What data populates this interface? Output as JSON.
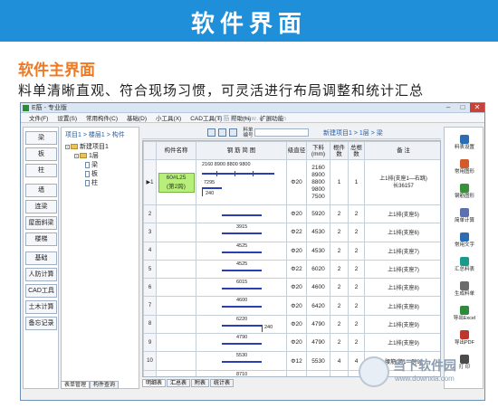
{
  "header": {
    "title": "软件界面",
    "subtitle": "软件主界面",
    "description": "料单清晰直观、符合现场习惯，可灵活进行布局调整和统计汇总"
  },
  "window": {
    "title": "E筋 - 专业版",
    "menu": [
      "文件(F)",
      "设置(S)",
      "常用构件(C)",
      "基础(D)",
      "小工具(X)",
      "CAD工具(T)",
      "帮助(H)",
      "扩展功能"
    ],
    "watermark": "E筋网  www.e-jin.cn"
  },
  "left_panel": {
    "buttons": [
      "梁",
      "板",
      "柱",
      "墙",
      "连梁",
      "屋面斜梁",
      "楼梯",
      "基础",
      "人防计算",
      "CAD工具",
      "土木计算",
      "备忘记录"
    ]
  },
  "tree": {
    "breadcrumb": "项目1 > 楼层1 > 构件",
    "nodes": [
      "新建项目1",
      "1层",
      "梁",
      "板",
      "柱"
    ],
    "bottom_tabs": [
      "表单管理",
      "构件查询"
    ]
  },
  "toolbar": {
    "label": "料单编号",
    "breadcrumb": "新建项目1 > 1层 > 梁"
  },
  "table": {
    "headers": [
      "",
      "构件名称",
      "钢 筋 简 图",
      "级直径",
      "下料(mm)",
      "根件数",
      "总根数",
      "备  注"
    ],
    "first_row": {
      "index": "1",
      "name_line1": "60#L25",
      "name_line2": "(第2跨)",
      "dims_top": "2160 8900 8800 9800",
      "dims_side": "7295",
      "dims_hook": "240",
      "grade": "Φ20",
      "length": [
        "2160",
        "8900",
        "8800",
        "9800",
        "7500"
      ],
      "count": "1",
      "total": "1",
      "note": "上1排(支座1—右跳)",
      "note2": "长36157"
    },
    "rows": [
      {
        "idx": "2",
        "dim": "",
        "grade": "Φ20",
        "len": "5920",
        "cnt": "2",
        "tot": "2",
        "note": "上1排(支座5)"
      },
      {
        "idx": "3",
        "dim": "3915",
        "grade": "Φ22",
        "len": "4530",
        "cnt": "2",
        "tot": "2",
        "note": "上1排(支座6)"
      },
      {
        "idx": "4",
        "dim": "4525",
        "grade": "Φ20",
        "len": "4530",
        "cnt": "2",
        "tot": "2",
        "note": "上1排(支座7)"
      },
      {
        "idx": "5",
        "dim": "4525",
        "grade": "Φ22",
        "len": "6020",
        "cnt": "2",
        "tot": "2",
        "note": "上1排(支座7)"
      },
      {
        "idx": "6",
        "dim": "6015",
        "grade": "Φ20",
        "len": "4600",
        "cnt": "2",
        "tot": "2",
        "note": "上1排(支座8)"
      },
      {
        "idx": "7",
        "dim": "4600",
        "grade": "Φ20",
        "len": "6420",
        "cnt": "2",
        "tot": "2",
        "note": "上1排(支座8)"
      },
      {
        "idx": "8",
        "dim": "6220",
        "grade": "Φ20",
        "len": "4790",
        "cnt": "2",
        "tot": "2",
        "note": "上1排(支座9)"
      },
      {
        "idx": "9",
        "dim": "4790",
        "grade": "Φ20",
        "len": "4790",
        "cnt": "2",
        "tot": "2",
        "note": "上1排(支座9)"
      },
      {
        "idx": "10",
        "dim": "5530",
        "grade": "Φ12",
        "len": "5530",
        "cnt": "4",
        "tot": "4",
        "note": "腰筋(跨1—跨9)"
      },
      {
        "idx": "11",
        "dim": "8710",
        "grade": "Φ12",
        "len": "8710",
        "cnt": "4",
        "tot": "4",
        "note": "腰筋(跨1—跨9)"
      }
    ],
    "extra_hook": "240",
    "sheet_tabs": [
      "明细表",
      "汇总表",
      "附表",
      "统计表"
    ]
  },
  "right_panel": {
    "items": [
      {
        "label": "料表设置",
        "color": "#2b6cb3"
      },
      {
        "label": "常用图形",
        "color": "#d35a2a"
      },
      {
        "label": "钢筋图形",
        "color": "#3a8f3a"
      },
      {
        "label": "简单计算",
        "color": "#5c6fb0"
      },
      {
        "label": "常用文字",
        "color": "#2b6cb3"
      },
      {
        "label": "汇总料表",
        "color": "#1a9a8a"
      },
      {
        "label": "生成料单",
        "color": "#6b6b6b"
      },
      {
        "label": "导出Excel",
        "color": "#2f8a3b"
      },
      {
        "label": "导出PDF",
        "color": "#c0352b"
      },
      {
        "label": "打  印",
        "color": "#4b4b4b"
      }
    ]
  },
  "logo": {
    "name": "当下软件园",
    "url": "www.downxia.com"
  }
}
